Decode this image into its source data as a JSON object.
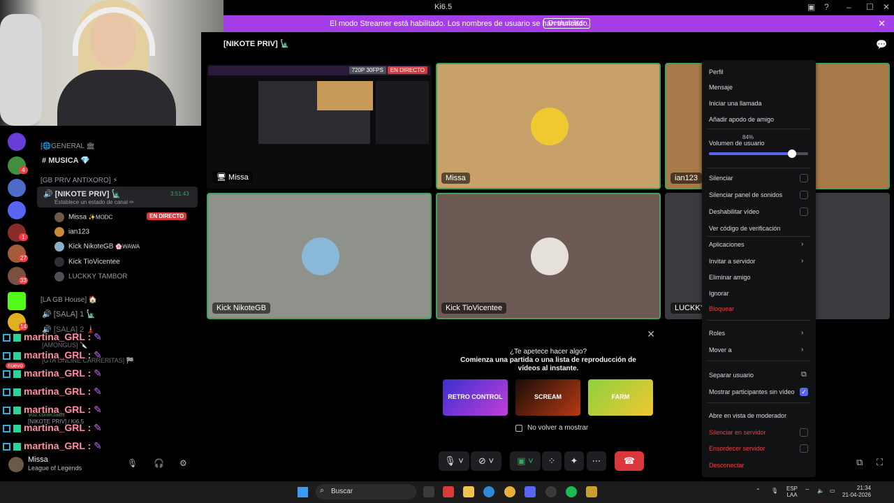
{
  "window": {
    "title": "Ki6.5"
  },
  "banner": {
    "text": "El modo Streamer está habilitado. Los nombres de usuario se han truncado.",
    "button": "Deshabilitar",
    "color": "#a53ee8"
  },
  "rail_badges": [
    "4",
    "1",
    "27",
    "33",
    "14"
  ],
  "sidebar": {
    "categories": {
      "general": "[🌐GENERAL 🏛",
      "priv": "[GB PRIV ANTIXORO] ⚡",
      "house": "[LA GB House] 🏠"
    },
    "musica": "MUSICA 💎",
    "active_channel": "[NIKOTE PRIV] 🗽",
    "active_status": "Establece un estado de canal ✏",
    "active_time": "3:51:43",
    "members": [
      {
        "name": "Missa",
        "tag": "✨MODC"
      },
      {
        "name": "ian123",
        "tag": ""
      },
      {
        "name": "Kick NikoteGB",
        "tag": "🌸WAWA"
      },
      {
        "name": "Kick TioVicentee",
        "tag": ""
      },
      {
        "name": "LUCKKY TAMBOR",
        "tag": ""
      }
    ],
    "live_badge": "EN DIRECTO",
    "sala1": "[SALA] 1 🗽",
    "sala2": "[SALA] 2 🗼",
    "amongus": "[AMONGUS] 🔪",
    "gta": "[GTA ONLINE CARRERITAS] 🏁",
    "nuevo": "nuevo",
    "voice_connected": "Voz conectada",
    "voice_channel": "[NIKOTE PRIV] / Ki6.5"
  },
  "chat_overlay": {
    "user": "martina_GRL",
    "sep": ":",
    "count": 7
  },
  "user_panel": {
    "name": "Missa",
    "status": "League of Legends"
  },
  "call": {
    "channel_title": "[NIKOTE PRIV] 🗽",
    "stream_badges": {
      "quality": "720P 30FPS",
      "live": "EN DIRECTO"
    },
    "tiles": [
      "Missa",
      "Missa",
      "ian123",
      "Kick NikoteGB",
      "Kick TioVicentee",
      "LUCKKY TAMBOR"
    ]
  },
  "activity": {
    "heading": "¿Te apetece hacer algo?",
    "subheading": "Comienza una partida o una lista de reproducción de vídeos al instante.",
    "games": [
      "RETRO CONTROL",
      "SCREAM",
      "FARM"
    ],
    "checkbox_label": "No volver a mostrar"
  },
  "context_menu": {
    "items": {
      "perfil": "Perfil",
      "mensaje": "Mensaje",
      "llamada": "Iniciar una llamada",
      "apodo": "Añadir apodo de amigo",
      "volumen": "Volumen de usuario",
      "silenciar": "Silenciar",
      "silenciar_panel": "Silenciar panel de sonidos",
      "deshabilitar_video": "Deshabilitar vídeo",
      "verificacion": "Ver código de verificación",
      "aplicaciones": "Aplicaciones",
      "invitar": "Invitar a servidor",
      "eliminar": "Eliminar amigo",
      "ignorar": "Ignorar",
      "bloquear": "Bloquear",
      "roles": "Roles",
      "mover": "Mover a",
      "separar": "Separar usuario",
      "mostrar_sin_video": "Mostrar participantes sin vídeo",
      "moderador": "Abre en vista de moderador",
      "silenciar_servidor": "Silenciar en servidor",
      "ensordecer_servidor": "Ensordecer servidor",
      "desconectar": "Desconectar"
    },
    "volume_percent": 84,
    "volume_label": "84%",
    "show_without_video_checked": true
  },
  "taskbar": {
    "search": "Buscar",
    "lang": "ESP",
    "lang2": "LAA",
    "time": "21:34",
    "date": "21-04-2026"
  },
  "colors": {
    "accent": "#5865f2",
    "danger": "#da373c",
    "speaking": "#3ba55d",
    "chat_name": "#ff8fa3"
  }
}
